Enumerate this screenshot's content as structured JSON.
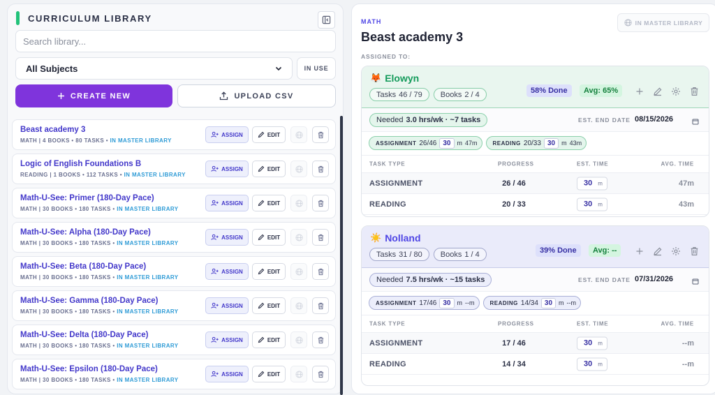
{
  "library": {
    "title": "CURRICULUM LIBRARY",
    "search_placeholder": "Search library...",
    "subject_filter": "All Subjects",
    "in_use_label": "IN USE",
    "create_label": "CREATE NEW",
    "upload_label": "UPLOAD CSV",
    "assign_label": "ASSIGN",
    "edit_label": "EDIT",
    "items": [
      {
        "name": "Beast academy 3",
        "meta": "MATH | 4 BOOKS • 80 TASKS • ",
        "master": "IN MASTER LIBRARY"
      },
      {
        "name": "Logic of English Foundations B",
        "meta": "READING | 1 BOOKS • 112 TASKS • ",
        "master": "IN MASTER LIBRARY"
      },
      {
        "name": "Math-U-See: Primer (180-Day Pace)",
        "meta": "MATH | 30 BOOKS • 180 TASKS • ",
        "master": "IN MASTER LIBRARY"
      },
      {
        "name": "Math-U-See: Alpha (180-Day Pace)",
        "meta": "MATH | 30 BOOKS • 180 TASKS • ",
        "master": "IN MASTER LIBRARY"
      },
      {
        "name": "Math-U-See: Beta (180-Day Pace)",
        "meta": "MATH | 30 BOOKS • 180 TASKS • ",
        "master": "IN MASTER LIBRARY"
      },
      {
        "name": "Math-U-See: Gamma (180-Day Pace)",
        "meta": "MATH | 30 BOOKS • 180 TASKS • ",
        "master": "IN MASTER LIBRARY"
      },
      {
        "name": "Math-U-See: Delta (180-Day Pace)",
        "meta": "MATH | 30 BOOKS • 180 TASKS • ",
        "master": "IN MASTER LIBRARY"
      },
      {
        "name": "Math-U-See: Epsilon (180-Day Pace)",
        "meta": "MATH | 30 BOOKS • 180 TASKS • ",
        "master": "IN MASTER LIBRARY"
      }
    ]
  },
  "detail": {
    "subject": "MATH",
    "title": "Beast academy 3",
    "master_button": "IN MASTER LIBRARY",
    "assigned_to_label": "ASSIGNED TO:",
    "est_end_label": "EST. END DATE",
    "table_headers": {
      "type": "TASK TYPE",
      "progress": "PROGRESS",
      "est": "EST. TIME",
      "avg": "AVG. TIME"
    },
    "students": [
      {
        "emoji": "🦊",
        "name": "Elowyn",
        "tasks_label": "Tasks",
        "tasks": "46 / 79",
        "books_label": "Books",
        "books": "2 / 4",
        "done": "58% Done",
        "avg": "Avg: 65%",
        "needed_label": "Needed",
        "needed": "3.0 hrs/wk · ~7 tasks",
        "end_date": "08/15/2026",
        "type_chips": [
          {
            "name": "ASSIGNMENT",
            "progress": "26/46",
            "time": "30",
            "unit": "m",
            "avg": "47m"
          },
          {
            "name": "READING",
            "progress": "20/33",
            "time": "30",
            "unit": "m",
            "avg": "43m"
          }
        ],
        "rows": [
          {
            "type": "ASSIGNMENT",
            "progress": "26 / 46",
            "est": "30",
            "unit": "m",
            "avg": "47m"
          },
          {
            "type": "READING",
            "progress": "20 / 33",
            "est": "30",
            "unit": "m",
            "avg": "43m"
          }
        ]
      },
      {
        "emoji": "☀️",
        "name": "Nolland",
        "tasks_label": "Tasks",
        "tasks": "31 / 80",
        "books_label": "Books",
        "books": "1 / 4",
        "done": "39% Done",
        "avg": "Avg: --",
        "needed_label": "Needed",
        "needed": "7.5 hrs/wk · ~15 tasks",
        "end_date": "07/31/2026",
        "type_chips": [
          {
            "name": "ASSIGNMENT",
            "progress": "17/46",
            "time": "30",
            "unit": "m",
            "avg": "--m"
          },
          {
            "name": "READING",
            "progress": "14/34",
            "time": "30",
            "unit": "m",
            "avg": "--m"
          }
        ],
        "rows": [
          {
            "type": "ASSIGNMENT",
            "progress": "17 / 46",
            "est": "30",
            "unit": "m",
            "avg": "--m"
          },
          {
            "type": "READING",
            "progress": "14 / 34",
            "est": "30",
            "unit": "m",
            "avg": "--m"
          }
        ]
      }
    ]
  },
  "colors": {
    "accent": "#7f34dc",
    "brand_indigo": "#4338ca",
    "green": "#22c27a"
  }
}
